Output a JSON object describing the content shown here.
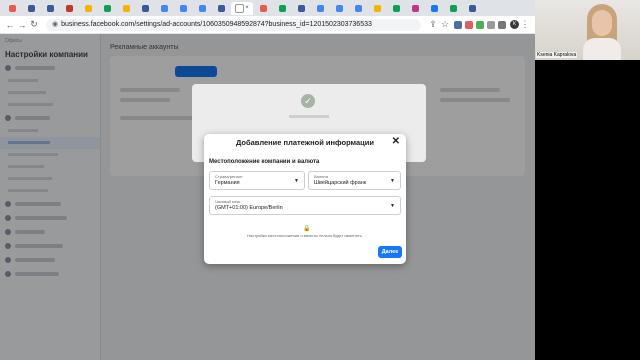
{
  "browser": {
    "url": "business.facebook.com/settings/ad-accounts/1060350948592874?business_id=1201502303736533",
    "tab_colors": [
      "#e85a4f",
      "#3b5998",
      "#3b5998",
      "#c0392b",
      "#f4b400",
      "#0f9d58",
      "#f4b400",
      "#3b5998",
      "#4285f4",
      "#4285f4",
      "#4285f4",
      "#3b5998",
      "#ffffff",
      "#e85a4f",
      "#0f9d58",
      "#3b5998",
      "#4285f4",
      "#4285f4",
      "#4285f4",
      "#f4b400",
      "#0f9d58",
      "#c13584",
      "#1877f2",
      "#0f9d58",
      "#3b5998"
    ],
    "profile_initial": "К"
  },
  "page": {
    "sidebar_brand": "Офисы",
    "sidebar_title": "Настройки компании",
    "main_title": "Рекламные аккаунты"
  },
  "modal": {
    "title": "Добавление платежной информации",
    "section": "Местоположение компании и валюта",
    "country_label": "Страна/регион",
    "country_value": "Германия",
    "currency_label": "Валюта",
    "currency_value": "Швейцарский франк",
    "timezone_label": "Часовой пояс",
    "timezone_value": "(GMT+01:00) Europe/Berlin",
    "note": "Настройки местоположения и валюты нельзя будет изменить.",
    "next_button": "Далее"
  },
  "webcam": {
    "name": "Ksenia Kapralova"
  },
  "colors": {
    "accent": "#1877f2"
  }
}
